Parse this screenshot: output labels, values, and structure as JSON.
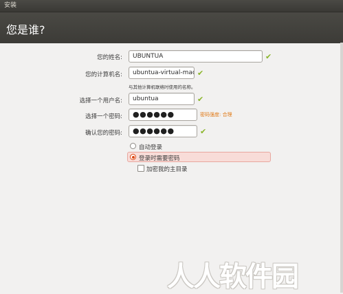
{
  "window": {
    "title": "安装"
  },
  "header": {
    "title": "您是谁?"
  },
  "form": {
    "name": {
      "label": "您的姓名:",
      "value": "UBUNTUA"
    },
    "computer": {
      "label": "您的计算机名:",
      "value": "ubuntua-virtual-mach",
      "hint": "与其他计算机联络时使用的名称。"
    },
    "username": {
      "label": "选择一个用户名:",
      "value": "ubuntua"
    },
    "password": {
      "label": "选择一个密码:",
      "value": "●●●●●●",
      "strength": "密码强度: 合理"
    },
    "confirm": {
      "label": "确认您的密码:",
      "value": "●●●●●●"
    }
  },
  "login_options": {
    "auto_login": {
      "label": "自动登录",
      "selected": false
    },
    "require_password": {
      "label": "登录时需要密码",
      "selected": true
    },
    "encrypt_home": {
      "label": "加密我的主目录",
      "checked": false
    }
  },
  "watermark": {
    "text": "人人软件园"
  },
  "colors": {
    "accent": "#dd4814",
    "check": "#8ab52a",
    "strength": "#e07a18",
    "header": "#3c3b37"
  }
}
